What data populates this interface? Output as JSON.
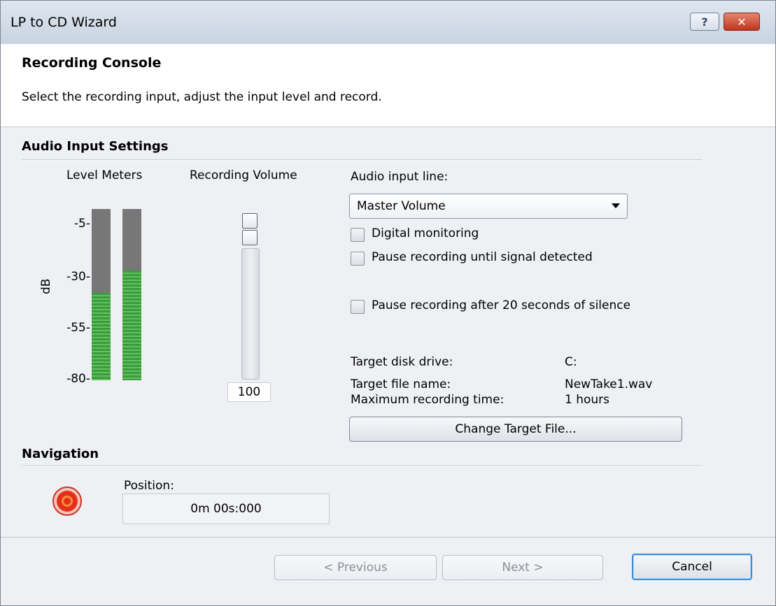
{
  "window": {
    "title": "LP to CD Wizard"
  },
  "titlebar_buttons": {
    "help": "?",
    "close": "✕"
  },
  "header": {
    "title": "Recording Console",
    "subtitle": "Select the recording input, adjust the input level and record."
  },
  "audio_input_settings": {
    "title": "Audio Input Settings",
    "level_meters": {
      "label": "Level Meters",
      "axis_label": "dB",
      "ticks": [
        "-5-",
        "-30-",
        "-55-",
        "-80-"
      ],
      "left_level_fraction": 0.51,
      "right_level_fraction": 0.64
    },
    "recording_volume": {
      "label": "Recording Volume",
      "value": "100",
      "level_fraction": 1.0
    },
    "audio_input_line": {
      "label": "Audio input line:",
      "selected": "Master Volume"
    },
    "checkboxes": [
      {
        "label": "Digital monitoring",
        "checked": false
      },
      {
        "label": "Pause recording until signal detected",
        "checked": false
      },
      {
        "label": "Pause recording after 20 seconds of silence",
        "checked": false
      }
    ],
    "target": {
      "disk_drive_label": "Target disk drive:",
      "disk_drive_value": "C:",
      "file_name_label": "Target file name:",
      "file_name_value": "NewTake1.wav",
      "max_time_label": "Maximum recording time:",
      "max_time_value": "1 hours"
    },
    "change_target_button": "Change Target File..."
  },
  "navigation": {
    "title": "Navigation",
    "position_label": "Position:",
    "position_value": "0m 00s:000"
  },
  "footer": {
    "previous": "< Previous",
    "next": "Next >",
    "cancel": "Cancel"
  },
  "colors": {
    "meter_green": "#3d9b3d",
    "meter_gray": "#777777",
    "record_red": "#e2301c",
    "default_button_border": "#3a8ed6"
  }
}
